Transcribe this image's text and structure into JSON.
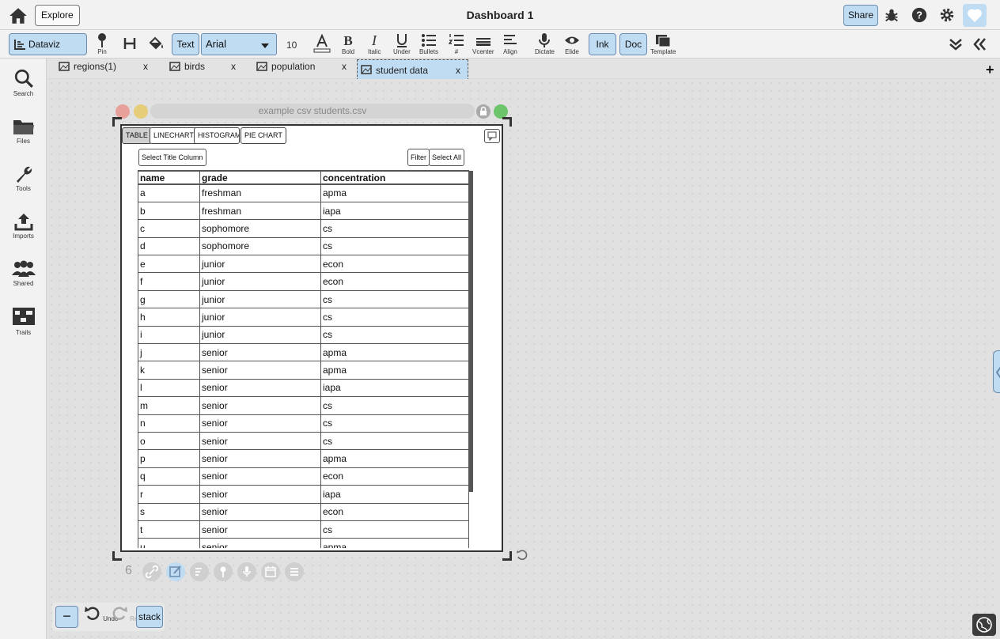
{
  "header": {
    "explore_label": "Explore",
    "title": "Dashboard 1",
    "share_label": "Share"
  },
  "toolbar": {
    "mode_label": "Dataviz",
    "pin_label": "Pin",
    "text_label": "Text",
    "font": "Arial",
    "font_size": "10",
    "bold_label": "Bold",
    "italic_label": "Italic",
    "under_label": "Under",
    "bullets_label": "Bullets",
    "number_label": "#",
    "vcenter_label": "Vcenter",
    "align_label": "Align",
    "dictate_label": "Dictate",
    "elide_label": "Elide",
    "ink_label": "Ink",
    "doc_label": "Doc",
    "template_label": "Template"
  },
  "sidebar": {
    "items": [
      {
        "label": "Search"
      },
      {
        "label": "Files"
      },
      {
        "label": "Tools"
      },
      {
        "label": "Imports"
      },
      {
        "label": "Shared"
      },
      {
        "label": "Trails"
      }
    ]
  },
  "tabs": [
    {
      "label": "regions(1)",
      "close": "x"
    },
    {
      "label": "birds",
      "close": "x"
    },
    {
      "label": "population",
      "close": "x"
    },
    {
      "label": "student data",
      "close": "x"
    }
  ],
  "document": {
    "title": "example csv students.csv",
    "view_tabs": [
      "TABLE",
      "LINECHART",
      "HISTOGRAM",
      "PIE CHART"
    ],
    "select_title_label": "Select Title Column",
    "filter_label": "Filter",
    "select_all_label": "Select All",
    "columns": [
      "name",
      "grade",
      "concentration"
    ],
    "rows": [
      [
        "a",
        "freshman",
        "apma"
      ],
      [
        "b",
        "freshman",
        "iapa"
      ],
      [
        "c",
        "sophomore",
        "cs"
      ],
      [
        "d",
        "sophomore",
        "cs"
      ],
      [
        "e",
        "junior",
        "econ"
      ],
      [
        "f",
        "junior",
        "econ"
      ],
      [
        "g",
        "junior",
        "cs"
      ],
      [
        "h",
        "junior",
        "cs"
      ],
      [
        "i",
        "junior",
        "cs"
      ],
      [
        "j",
        "senior",
        "apma"
      ],
      [
        "k",
        "senior",
        "apma"
      ],
      [
        "l",
        "senior",
        "iapa"
      ],
      [
        "m",
        "senior",
        "cs"
      ],
      [
        "n",
        "senior",
        "cs"
      ],
      [
        "o",
        "senior",
        "cs"
      ],
      [
        "p",
        "senior",
        "apma"
      ],
      [
        "q",
        "senior",
        "econ"
      ],
      [
        "r",
        "senior",
        "iapa"
      ],
      [
        "s",
        "senior",
        "econ"
      ],
      [
        "t",
        "senior",
        "cs"
      ],
      [
        "u",
        "senior",
        "apma"
      ]
    ],
    "link_count": "6"
  },
  "bottom": {
    "undo_label": "Undo",
    "redo_label": "Redo",
    "stack_label": "stack"
  },
  "colors": {
    "accent": "#bfdcf3",
    "close_dot": "#e8a09a",
    "min_dot": "#e6cd7a",
    "max_dot": "#6cc56a"
  }
}
